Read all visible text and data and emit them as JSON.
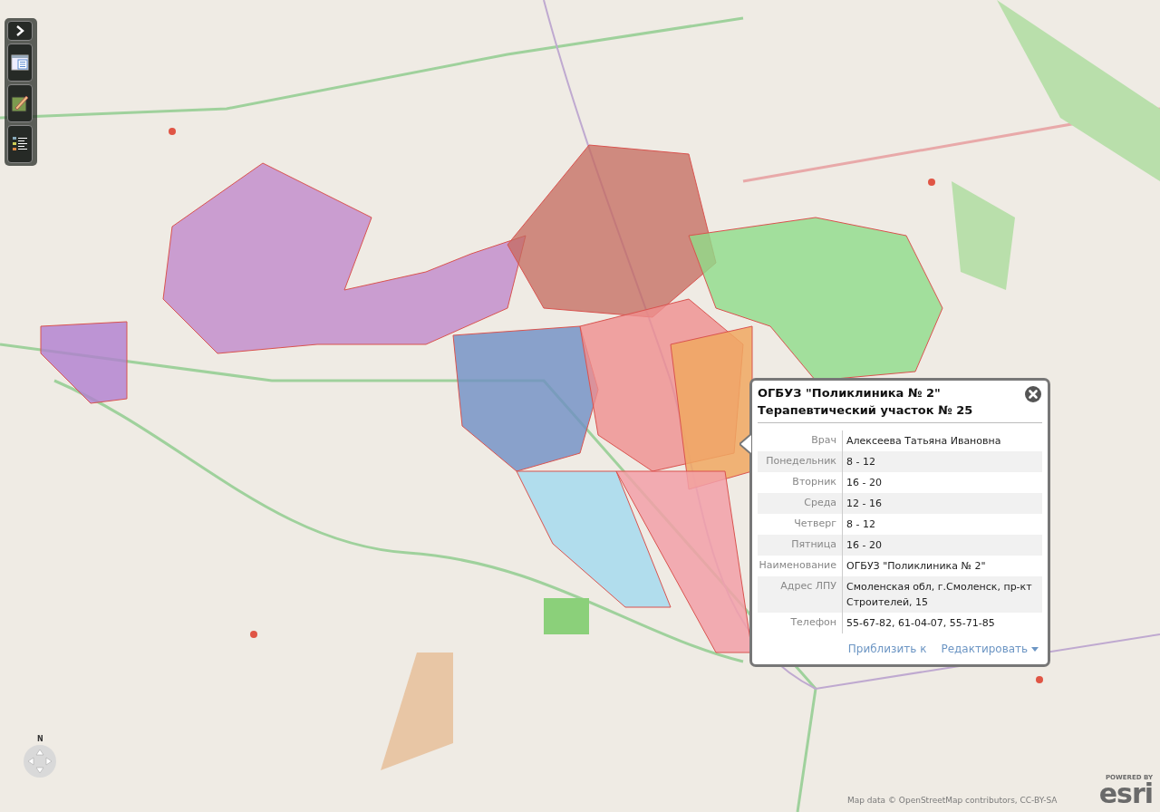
{
  "popup": {
    "title": "ОГБУЗ \"Поликлиника № 2\"",
    "subtitle": "Терапевтический участок № 25",
    "fields": [
      {
        "label": "Врач",
        "value": "Алексеева Татьяна Ивановна"
      },
      {
        "label": "Понедельник",
        "value": "8 - 12"
      },
      {
        "label": "Вторник",
        "value": "16 - 20"
      },
      {
        "label": "Среда",
        "value": "12 - 16"
      },
      {
        "label": "Четверг",
        "value": "8 - 12"
      },
      {
        "label": "Пятница",
        "value": "16 - 20"
      },
      {
        "label": "Наименование",
        "value": "ОГБУЗ \"Поликлиника № 2\""
      },
      {
        "label": "Адрес ЛПУ",
        "value": "Смоленская обл, г.Смоленск, пр-кт Строителей, 15"
      },
      {
        "label": "Телефон",
        "value": "55-67-82, 61-04-07, 55-71-85"
      }
    ],
    "actions": [
      {
        "label": "Приблизить к",
        "kind": "link"
      },
      {
        "label": "Редактировать",
        "kind": "menu"
      }
    ]
  },
  "toolbar": [
    {
      "kind": "expand"
    },
    {
      "kind": "layers"
    },
    {
      "kind": "edit"
    },
    {
      "kind": "legend"
    }
  ],
  "pan_control": {
    "north_label": "N"
  },
  "attribution": "Map data © OpenStreetMap contributors, CC-BY-SA",
  "logo": {
    "tagline": "POWERED BY",
    "name": "esri"
  }
}
